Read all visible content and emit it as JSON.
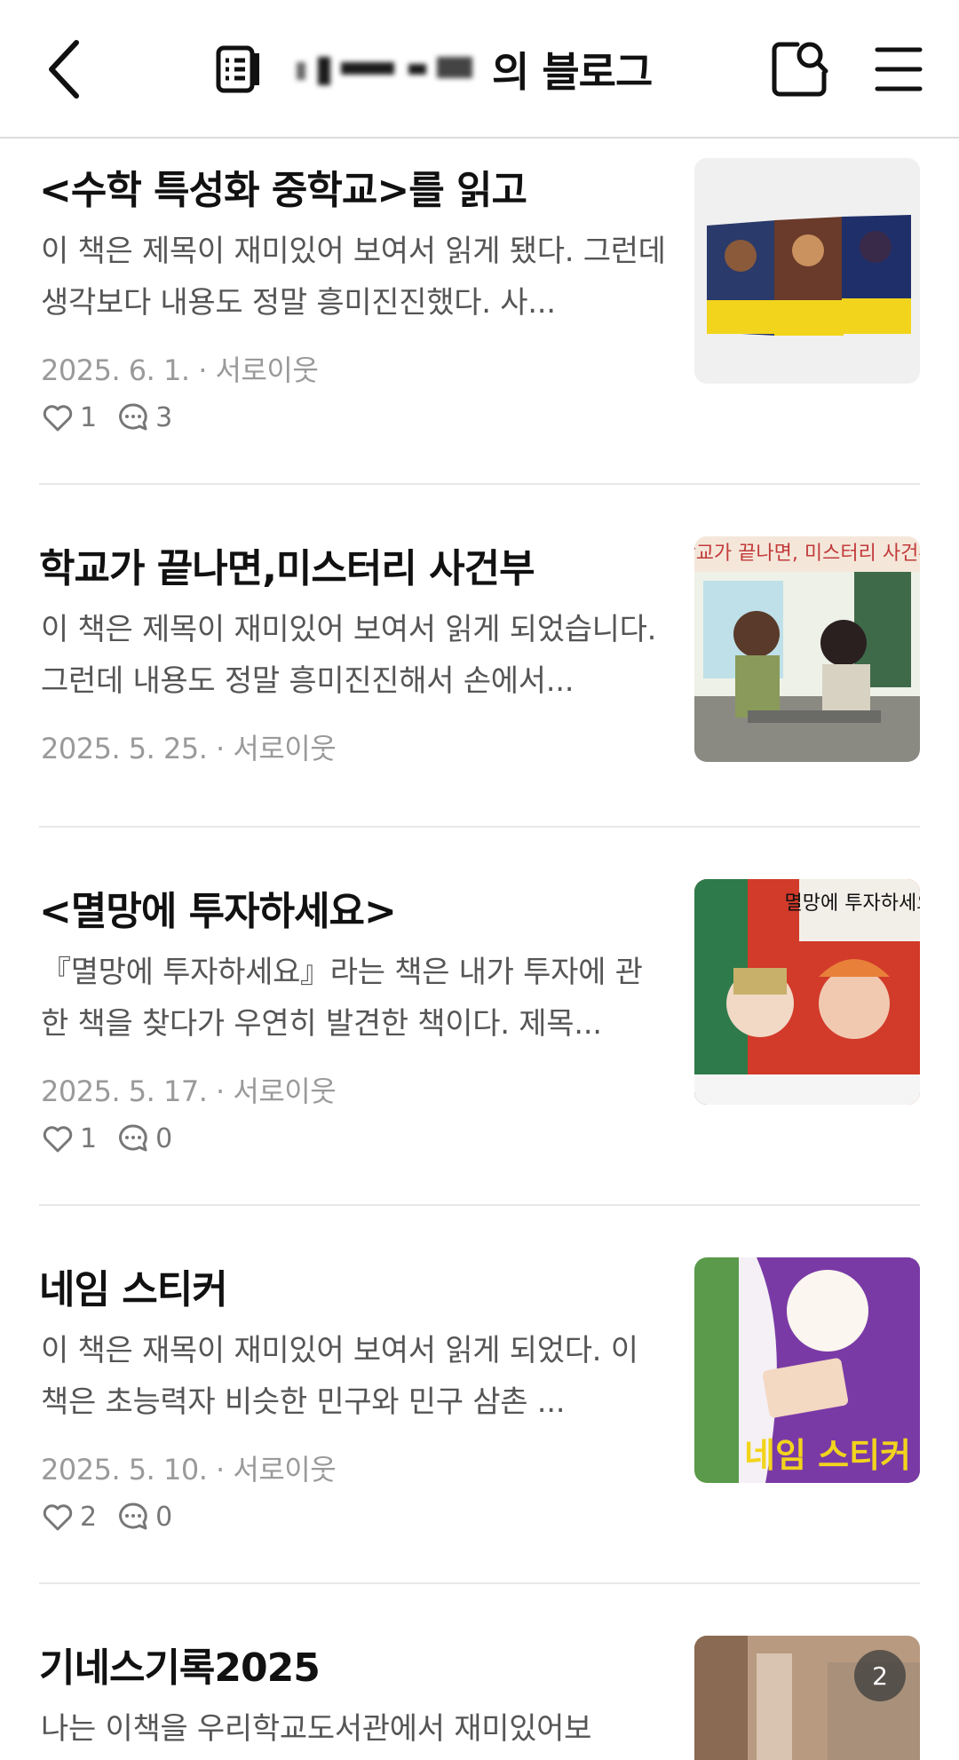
{
  "header": {
    "title_suffix": "의 블로그"
  },
  "posts": [
    {
      "title": "<수학 특성화 중학교>를 읽고",
      "excerpt": "이 책은 제목이 재미있어 보여서 읽게 됐다. 그런데 생각보다 내용도 정말 흥미진진했다. 사...",
      "date": "2025. 6. 1.",
      "relation": "서로이웃",
      "likes": "1",
      "comments": "3"
    },
    {
      "title": "학교가 끝나면,미스터리 사건부",
      "excerpt": "이 책은 제목이 재미있어 보여서 읽게 되었습니다. 그런데 내용도 정말 흥미진진해서 손에서...",
      "date": "2025. 5. 25.",
      "relation": "서로이웃",
      "thumb_text": "학교가 끝나면, 미스터리 사건부"
    },
    {
      "title": "<멸망에 투자하세요>",
      "excerpt": "『멸망에 투자하세요』라는 책은 내가 투자에 관한 책을 찾다가 우연히 발견한 책이다. 제목...",
      "date": "2025. 5. 17.",
      "relation": "서로이웃",
      "likes": "1",
      "comments": "0",
      "thumb_text": "멸망에 투자하세요"
    },
    {
      "title": "네임 스티커",
      "excerpt": "이 책은 재목이 재미있어 보여서 읽게 되었다. 이 책은 초능력자 비슷한 민구와 민구 삼촌 ...",
      "date": "2025. 5. 10.",
      "relation": "서로이웃",
      "likes": "2",
      "comments": "0",
      "thumb_text": "네임 스티커"
    },
    {
      "title": "기네스기록2025",
      "excerpt": "나는 이책을 우리학교도서관에서 재미있어보",
      "image_count": "2"
    }
  ]
}
